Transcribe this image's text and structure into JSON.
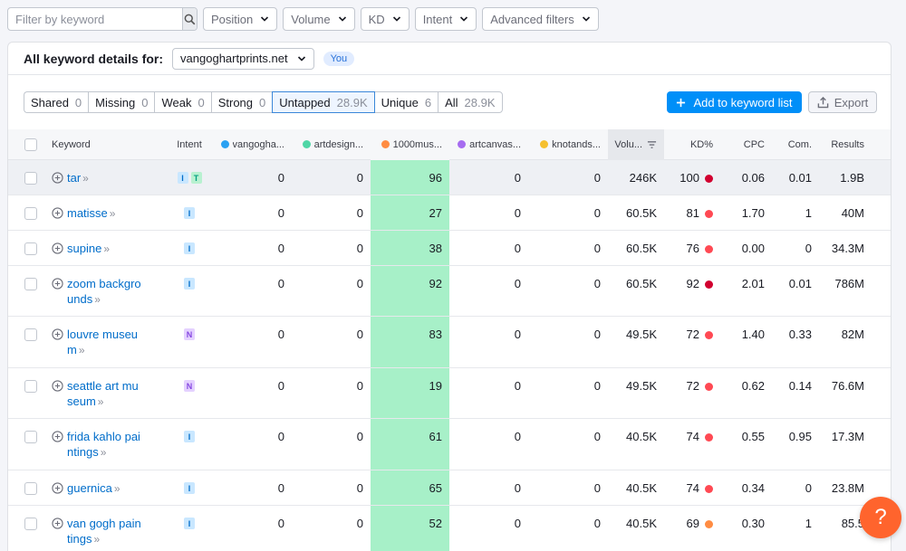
{
  "filters": {
    "search_placeholder": "Filter by keyword",
    "dropdowns": [
      "Position",
      "Volume",
      "KD",
      "Intent",
      "Advanced filters"
    ]
  },
  "panel": {
    "title": "All keyword details for:",
    "domain": "vangoghartprints.net",
    "you_badge": "You"
  },
  "segments": [
    {
      "label": "Shared",
      "count": "0"
    },
    {
      "label": "Missing",
      "count": "0"
    },
    {
      "label": "Weak",
      "count": "0"
    },
    {
      "label": "Strong",
      "count": "0"
    },
    {
      "label": "Untapped",
      "count": "28.9K",
      "active": true
    },
    {
      "label": "Unique",
      "count": "6"
    },
    {
      "label": "All",
      "count": "28.9K"
    }
  ],
  "actions": {
    "add_label": "Add to keyword list",
    "export_label": "Export"
  },
  "columns": {
    "keyword": "Keyword",
    "intent": "Intent",
    "domains": [
      {
        "label": "vangogha...",
        "color": "#2aa1f2"
      },
      {
        "label": "artdesign...",
        "color": "#4fd6a6"
      },
      {
        "label": "1000mus...",
        "color": "#ff8c42"
      },
      {
        "label": "artcanvas...",
        "color": "#a66cf0"
      },
      {
        "label": "knotands...",
        "color": "#f5c030"
      }
    ],
    "volume": "Volu...",
    "kd": "KD%",
    "cpc": "CPC",
    "com": "Com.",
    "results": "Results"
  },
  "rows": [
    {
      "kw1": "tar",
      "kw2": "",
      "intent": [
        "I",
        "T"
      ],
      "d": [
        "0",
        "0",
        "96",
        "0",
        "0"
      ],
      "volume": "246K",
      "kd": "100",
      "kd_color": "#d1002f",
      "cpc": "0.06",
      "com": "0.01",
      "results": "1.9B"
    },
    {
      "kw1": "matisse",
      "kw2": "",
      "intent": [
        "I"
      ],
      "d": [
        "0",
        "0",
        "27",
        "0",
        "0"
      ],
      "volume": "60.5K",
      "kd": "81",
      "kd_color": "#ff4953",
      "cpc": "1.70",
      "com": "1",
      "results": "40M"
    },
    {
      "kw1": "supine",
      "kw2": "",
      "intent": [
        "I"
      ],
      "d": [
        "0",
        "0",
        "38",
        "0",
        "0"
      ],
      "volume": "60.5K",
      "kd": "76",
      "kd_color": "#ff4953",
      "cpc": "0.00",
      "com": "0",
      "results": "34.3M"
    },
    {
      "kw1": "zoom backgro",
      "kw2": "unds",
      "intent": [
        "I"
      ],
      "d": [
        "0",
        "0",
        "92",
        "0",
        "0"
      ],
      "volume": "60.5K",
      "kd": "92",
      "kd_color": "#d1002f",
      "cpc": "2.01",
      "com": "0.01",
      "results": "786M"
    },
    {
      "kw1": "louvre museu",
      "kw2": "m",
      "intent": [
        "N"
      ],
      "d": [
        "0",
        "0",
        "83",
        "0",
        "0"
      ],
      "volume": "49.5K",
      "kd": "72",
      "kd_color": "#ff4953",
      "cpc": "1.40",
      "com": "0.33",
      "results": "82M"
    },
    {
      "kw1": "seattle art mu",
      "kw2": "seum",
      "intent": [
        "N"
      ],
      "d": [
        "0",
        "0",
        "19",
        "0",
        "0"
      ],
      "volume": "49.5K",
      "kd": "72",
      "kd_color": "#ff4953",
      "cpc": "0.62",
      "com": "0.14",
      "results": "76.6M"
    },
    {
      "kw1": "frida kahlo pai",
      "kw2": "ntings",
      "intent": [
        "I"
      ],
      "d": [
        "0",
        "0",
        "61",
        "0",
        "0"
      ],
      "volume": "40.5K",
      "kd": "74",
      "kd_color": "#ff4953",
      "cpc": "0.55",
      "com": "0.95",
      "results": "17.3M"
    },
    {
      "kw1": "guernica",
      "kw2": "",
      "intent": [
        "I"
      ],
      "d": [
        "0",
        "0",
        "65",
        "0",
        "0"
      ],
      "volume": "40.5K",
      "kd": "74",
      "kd_color": "#ff4953",
      "cpc": "0.34",
      "com": "0",
      "results": "23.8M"
    },
    {
      "kw1": "van gogh pain",
      "kw2": "tings",
      "intent": [
        "I"
      ],
      "d": [
        "0",
        "0",
        "52",
        "0",
        "0"
      ],
      "volume": "40.5K",
      "kd": "69",
      "kd_color": "#ff8c42",
      "cpc": "0.30",
      "com": "1",
      "results": "85.5"
    }
  ],
  "help_label": "?"
}
